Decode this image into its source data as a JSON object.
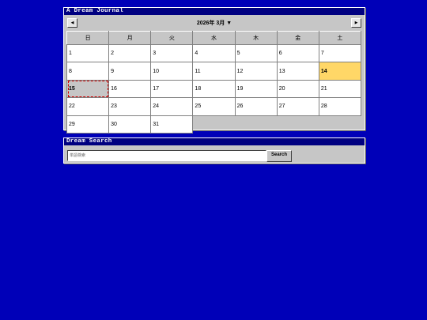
{
  "calendar": {
    "title": "A Dream Journal",
    "prev_label": "◀",
    "next_label": "▶",
    "month_label": "2026年 3月 ▼",
    "weekdays": [
      "日",
      "月",
      "火",
      "水",
      "木",
      "金",
      "土"
    ],
    "weeks": [
      [
        {
          "day": "1"
        },
        {
          "day": "2"
        },
        {
          "day": "3"
        },
        {
          "day": "4"
        },
        {
          "day": "5"
        },
        {
          "day": "6"
        },
        {
          "day": "7"
        }
      ],
      [
        {
          "day": "8"
        },
        {
          "day": "9"
        },
        {
          "day": "10"
        },
        {
          "day": "11"
        },
        {
          "day": "12"
        },
        {
          "day": "13"
        },
        {
          "day": "14",
          "state": "selected"
        }
      ],
      [
        {
          "day": "15",
          "state": "today"
        },
        {
          "day": "16"
        },
        {
          "day": "17"
        },
        {
          "day": "18"
        },
        {
          "day": "19"
        },
        {
          "day": "20"
        },
        {
          "day": "21"
        }
      ],
      [
        {
          "day": "22"
        },
        {
          "day": "23"
        },
        {
          "day": "24"
        },
        {
          "day": "25"
        },
        {
          "day": "26"
        },
        {
          "day": "27"
        },
        {
          "day": "28"
        }
      ],
      [
        {
          "day": "29"
        },
        {
          "day": "30"
        },
        {
          "day": "31"
        },
        null,
        null,
        null,
        null
      ]
    ]
  },
  "search": {
    "title": "Dream Search",
    "placeholder": "単語検索",
    "value": "",
    "button_label": "Search"
  },
  "colors": {
    "desktop": "#0000b8",
    "titlebar": "#000080",
    "window": "#c6c6c6",
    "selected_day": "#ffd767",
    "today_outline": "#cc0000"
  }
}
